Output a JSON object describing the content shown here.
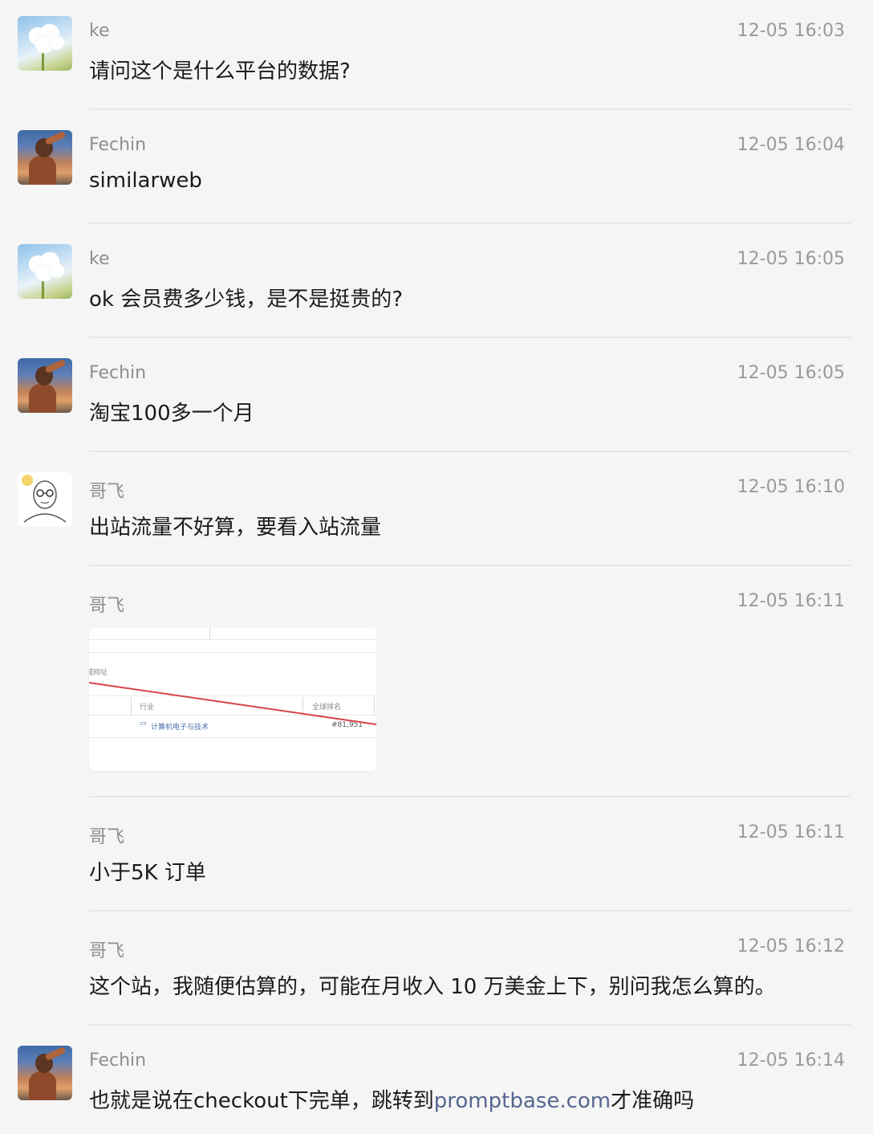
{
  "messages": [
    {
      "name": "ke",
      "time": "12-05 16:03",
      "text": "请问这个是什么平台的数据?"
    },
    {
      "name": "Fechin",
      "time": "12-05 16:04",
      "text": "similarweb"
    },
    {
      "name": "ke",
      "time": "12-05 16:05",
      "text": "ok 会员费多少钱，是不是挺贵的?"
    },
    {
      "name": "Fechin",
      "time": "12-05 16:05",
      "text": "淘宝100多一个月"
    },
    {
      "name": "哥飞",
      "time": "12-05 16:10",
      "text": "出站流量不好算，要看入站流量"
    },
    {
      "name": "哥飞",
      "time": "12-05 16:11",
      "image": {
        "col_site": "域网址",
        "col_industry": "行业",
        "col_rank": "全球排名",
        "industry_value": "计算机电子与技术",
        "rank_value": "#81,951"
      }
    },
    {
      "name": "哥飞",
      "time": "12-05 16:11",
      "text": "小于5K 订单"
    },
    {
      "name": "哥飞",
      "time": "12-05 16:12",
      "text": "这个站，我随便估算的，可能在月收入 10 万美金上下，别问我怎么算的。"
    },
    {
      "name": "Fechin",
      "time": "12-05 16:14",
      "text_before": "也就是说在checkout下完单，跳转到",
      "link": "promptbase.com",
      "text_after": "才准确吗"
    }
  ],
  "colors": {
    "background": "#f5f5f5",
    "name": "#8e8e8e",
    "time": "#9a9a9a",
    "text": "#1b1b1b",
    "link": "#56668f",
    "divider": "#e6e6e6",
    "red_line": "#d9434b"
  },
  "icons": {
    "ke": "white-flower-avatar",
    "Fechin": "sunset-person-avatar",
    "gefei": "bald-glasses-cartoon-avatar"
  }
}
